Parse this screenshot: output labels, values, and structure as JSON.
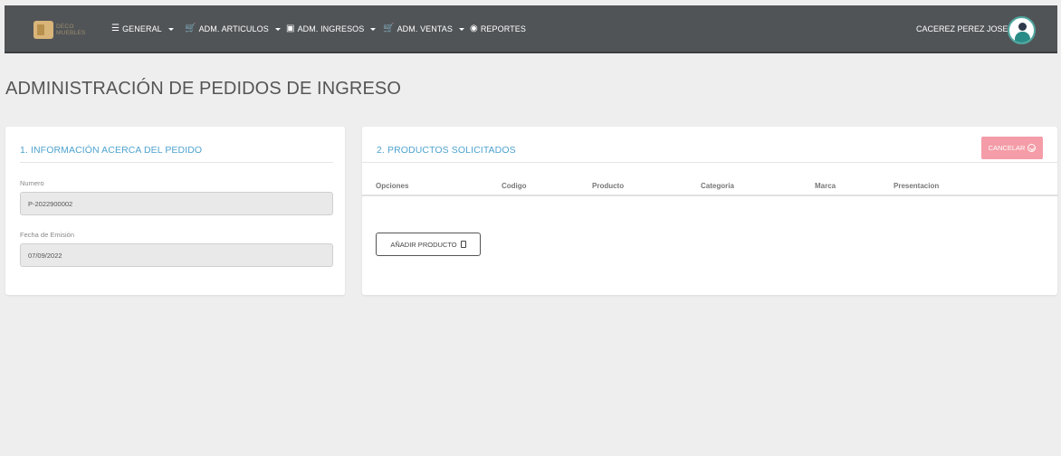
{
  "navbar": {
    "brand_text_line1": "DECO",
    "brand_text_line2": "MUEBLES",
    "menu": [
      {
        "icon": "list-icon",
        "glyph": "☰",
        "label": "GENERAL"
      },
      {
        "icon": "cart-icon",
        "glyph": "🛒",
        "label": "ADM. ARTICULOS"
      },
      {
        "icon": "box-icon",
        "glyph": "▣",
        "label": "ADM. INGRESOS"
      },
      {
        "icon": "cart-icon",
        "glyph": "🛒",
        "label": "ADM. VENTAS"
      },
      {
        "icon": "eye-icon",
        "glyph": "◉",
        "label": "REPORTES"
      }
    ],
    "user_name": "CACEREZ PEREZ JOSE"
  },
  "page": {
    "title": "ADMINISTRACIÓN DE PEDIDOS DE INGRESO"
  },
  "order_info": {
    "title": "1. INFORMACIÓN ACERCA DEL PEDIDO",
    "numero_label": "Numero",
    "numero_value": "P-2022900002",
    "fecha_label": "Fecha de Emisión",
    "fecha_value": "07/09/2022"
  },
  "products": {
    "title": "2. PRODUCTOS SOLICITADOS",
    "cancel_label": "CANCELAR",
    "columns": [
      "Opciones",
      "Codigo",
      "Producto",
      "Categoria",
      "Marca",
      "Presentacion"
    ],
    "add_label": "AÑADIR PRODUCTO"
  },
  "colors": {
    "navbar": "#515457",
    "accent": "#4fa3cf",
    "cancel": "#f49ca7"
  }
}
